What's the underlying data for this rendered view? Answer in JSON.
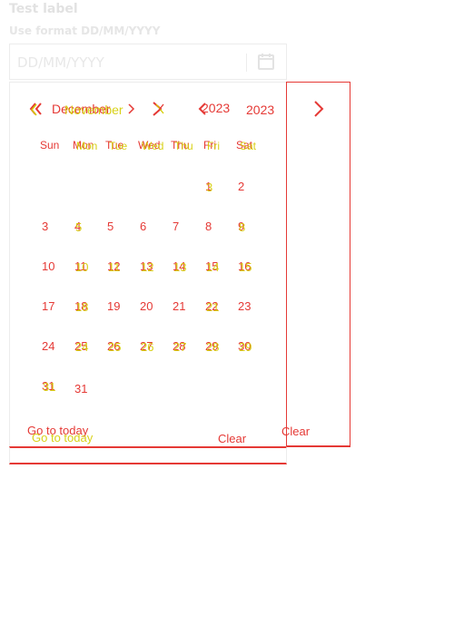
{
  "field": {
    "label": "Test label",
    "hint": "Use format DD/MM/YYYY",
    "placeholder": "DD/MM/YYYY",
    "calendar_icon": "calendar-icon"
  },
  "calendar": {
    "month_text_a": "December",
    "month_text_b": "November",
    "year_text_a": "2023",
    "year_text_b": "2023",
    "weekdays": [
      "Sun",
      "Mon",
      "Tue",
      "Wed",
      "Thu",
      "Fri",
      "Sat"
    ],
    "weekdays_ghost": [
      "Mon",
      "Tue",
      "Wed",
      "Thu",
      "Fri",
      "Sat"
    ],
    "rows": [
      [
        "",
        "",
        "",
        "",
        "",
        "1",
        "2"
      ],
      [
        "3",
        "4",
        "5",
        "6",
        "7",
        "8",
        "9"
      ],
      [
        "10",
        "11",
        "12",
        "13",
        "14",
        "15",
        "16"
      ],
      [
        "17",
        "18",
        "19",
        "20",
        "21",
        "22",
        "23"
      ],
      [
        "24",
        "25",
        "26",
        "27",
        "28",
        "29",
        "30"
      ],
      [
        "31",
        "",
        "",
        "",
        "",
        "",
        ""
      ]
    ],
    "ghost_rows": [
      [
        "",
        "",
        "",
        "",
        "",
        "3",
        ""
      ],
      [
        "",
        "5",
        "",
        "",
        "",
        "",
        "8"
      ],
      [
        "",
        "10",
        "11",
        "12",
        "13",
        "14",
        "15"
      ],
      [
        "",
        "18",
        "",
        "",
        "",
        "21",
        ""
      ],
      [
        "",
        "24",
        "25",
        "26",
        "27",
        "28",
        "29"
      ],
      [
        "31",
        "",
        "",
        "",
        "",
        "",
        ""
      ]
    ],
    "footer": {
      "go_to_today": "Go to today",
      "clear": "Clear"
    }
  },
  "colors": {
    "overlay_red": "#e53935",
    "overlay_yellow": "#d4cd00",
    "border": "#ececec",
    "muted_text": "#e2e2e2"
  }
}
